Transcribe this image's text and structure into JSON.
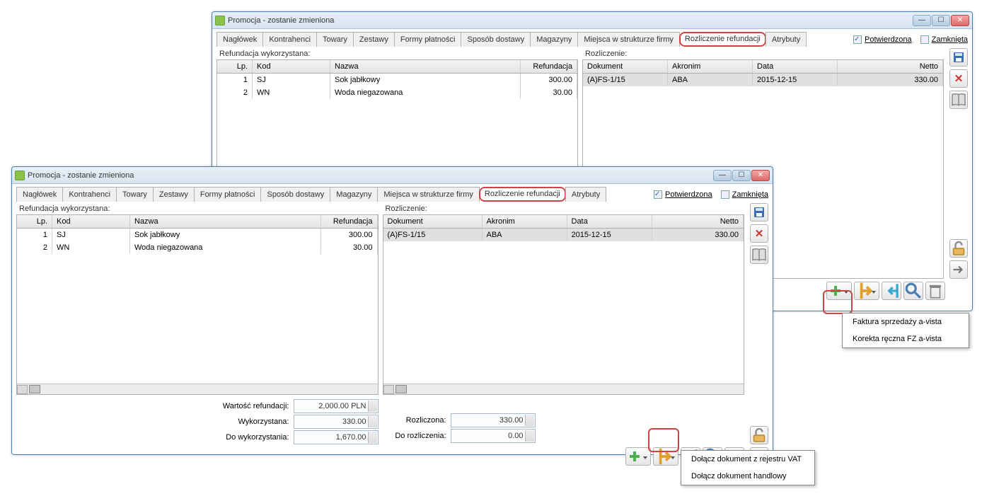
{
  "window_back": {
    "title": "Promocja - zostanie zmieniona",
    "tabs": [
      "Nagłówek",
      "Kontrahenci",
      "Towary",
      "Zestawy",
      "Formy płatności",
      "Sposób dostawy",
      "Magazyny",
      "Miejsca w strukturze firmy",
      "Rozliczenie refundacji",
      "Atrybuty"
    ],
    "checkboxes": {
      "potwierdzona": "Potwierdzona",
      "zamknieta": "Zamknięta"
    },
    "left_label": "Refundacja wykorzystana:",
    "right_label": "Rozliczenie:",
    "left_columns": [
      "Lp.",
      "Kod",
      "Nazwa",
      "Refundacja"
    ],
    "left_rows": [
      {
        "lp": "1",
        "kod": "SJ",
        "nazwa": "Sok jabłkowy",
        "ref": "300.00"
      },
      {
        "lp": "2",
        "kod": "WN",
        "nazwa": "Woda niegazowana",
        "ref": "30.00"
      }
    ],
    "right_columns": [
      "Dokument",
      "Akronim",
      "Data",
      "Netto"
    ],
    "right_rows": [
      {
        "dok": "(A)FS-1/15",
        "akr": "ABA",
        "data": "2015-12-15",
        "netto": "330.00"
      }
    ],
    "popup": {
      "item1": "Faktura sprzedaży a-vista",
      "item2": "Korekta ręczna FZ a-vista"
    }
  },
  "window_front": {
    "title": "Promocja - zostanie zmieniona",
    "tabs": [
      "Nagłówek",
      "Kontrahenci",
      "Towary",
      "Zestawy",
      "Formy płatności",
      "Sposób dostawy",
      "Magazyny",
      "Miejsca w strukturze firmy",
      "Rozliczenie refundacji",
      "Atrybuty"
    ],
    "checkboxes": {
      "potwierdzona": "Potwierdzona",
      "zamknieta": "Zamknięta"
    },
    "left_label": "Refundacja wykorzystana:",
    "right_label": "Rozliczenie:",
    "left_columns": [
      "Lp.",
      "Kod",
      "Nazwa",
      "Refundacja"
    ],
    "left_rows": [
      {
        "lp": "1",
        "kod": "SJ",
        "nazwa": "Sok jabłkowy",
        "ref": "300.00"
      },
      {
        "lp": "2",
        "kod": "WN",
        "nazwa": "Woda niegazowana",
        "ref": "30.00"
      }
    ],
    "right_columns": [
      "Dokument",
      "Akronim",
      "Data",
      "Netto"
    ],
    "right_rows": [
      {
        "dok": "(A)FS-1/15",
        "akr": "ABA",
        "data": "2015-12-15",
        "netto": "330.00"
      }
    ],
    "fields": {
      "wartosc_label": "Wartość refundacji:",
      "wartosc_val": "2,000.00 PLN",
      "wyk_label": "Wykorzystana:",
      "wyk_val": "330.00",
      "do_wyk_label": "Do wykorzystania:",
      "do_wyk_val": "1,670.00",
      "rozl_label": "Rozliczona:",
      "rozl_val": "330.00",
      "do_rozl_label": "Do rozliczenia:",
      "do_rozl_val": "0.00"
    },
    "popup": {
      "item1": "Dołącz dokument z rejestru VAT",
      "item2": "Dołącz dokument handlowy"
    }
  }
}
